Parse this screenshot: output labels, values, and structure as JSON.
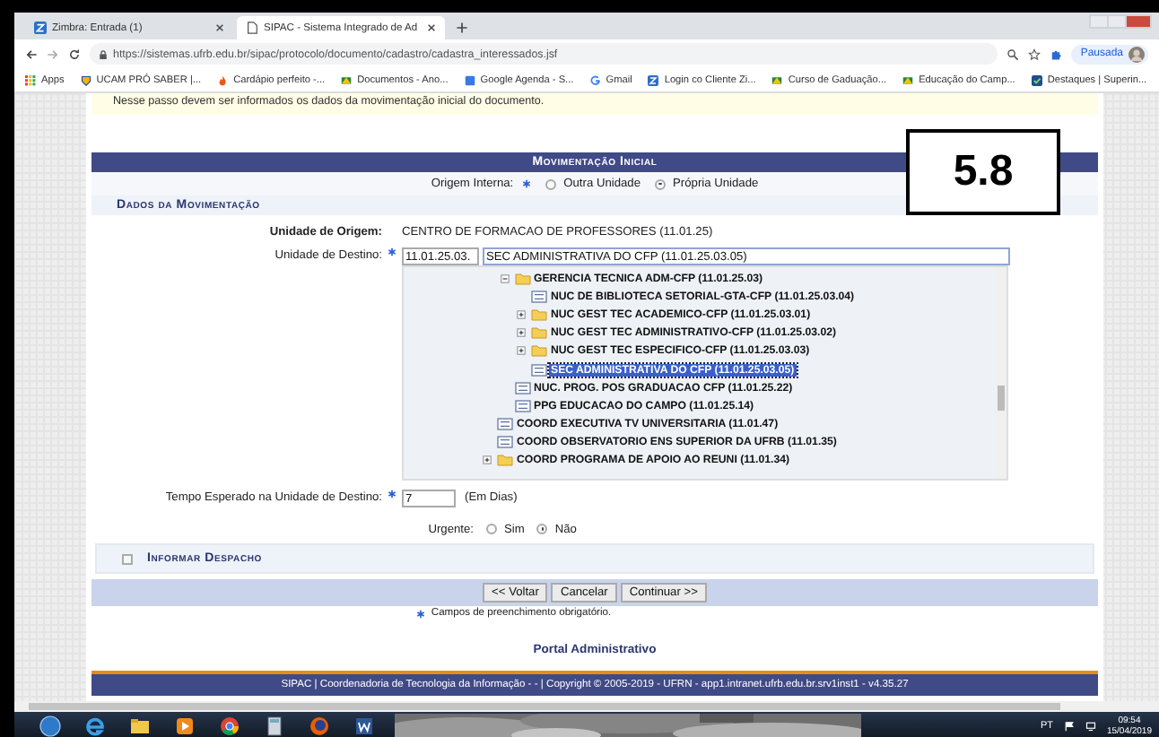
{
  "browser": {
    "tabs": [
      {
        "title": "Zimbra: Entrada (1)",
        "kind": "zimbra",
        "selected": false
      },
      {
        "title": "SIPAC - Sistema Integrado de Ad",
        "kind": "page",
        "selected": true
      }
    ],
    "url": "https://sistemas.ufrb.edu.br/sipac/protocolo/documento/cadastro/cadastra_interessados.jsf",
    "profile": "Pausada",
    "bookmarks": [
      {
        "label": "Apps",
        "kind": "apps"
      },
      {
        "label": "UCAM PRÓ SABER |...",
        "kind": "shield"
      },
      {
        "label": "Cardápio perfeito -...",
        "kind": "flame"
      },
      {
        "label": "Documentos - Ano...",
        "kind": "drive"
      },
      {
        "label": "Google Agenda - S...",
        "kind": "calendar"
      },
      {
        "label": "Gmail",
        "kind": "google"
      },
      {
        "label": "Login co Cliente Zi...",
        "kind": "zimbra"
      },
      {
        "label": "Curso de Gaduação...",
        "kind": "drive"
      },
      {
        "label": "Educação do Camp...",
        "kind": "drive"
      },
      {
        "label": "Destaques | Superin...",
        "kind": "check"
      }
    ]
  },
  "page": {
    "notice": "Nesse passo devem ser informados os dados da movimentação inicial do documento.",
    "title": "Movimentação Inicial",
    "origin": {
      "label": "Origem Interna:",
      "required": true,
      "options": [
        {
          "label": "Outra Unidade",
          "selected": false
        },
        {
          "label": "Própria Unidade",
          "selected": true
        }
      ]
    },
    "section": "Dados da Movimentação",
    "origin_unit": {
      "label": "Unidade de Origem:",
      "value": "CENTRO DE FORMACAO DE PROFESSORES (11.01.25)"
    },
    "destination": {
      "label": "Unidade de Destino:",
      "required": true,
      "code": "11.01.25.03.",
      "name": "SEC ADMINISTRATIVA DO CFP (11.01.25.03.05)"
    },
    "tree": {
      "items": [
        {
          "children": [
            {
              "label": "GERENCIA TECNICA ADM-CFP (11.01.25.03)",
              "kind": "folder",
              "expanded": true,
              "selected": false,
              "children": [
                {
                  "label": "NUC DE BIBLIOTECA SETORIAL-GTA-CFP (11.01.25.03.04)",
                  "kind": "leaf",
                  "selected": false
                },
                {
                  "label": "NUC GEST TEC ACADEMICO-CFP (11.01.25.03.01)",
                  "kind": "folder",
                  "expanded": false,
                  "selected": false
                },
                {
                  "label": "NUC GEST TEC ADMINISTRATIVO-CFP (11.01.25.03.02)",
                  "kind": "folder",
                  "expanded": false,
                  "selected": false
                },
                {
                  "label": "NUC GEST TEC ESPECIFICO-CFP (11.01.25.03.03)",
                  "kind": "folder",
                  "expanded": false,
                  "selected": false
                },
                {
                  "label": "SEC ADMINISTRATIVA DO CFP (11.01.25.03.05)",
                  "kind": "leaf",
                  "selected": true
                }
              ]
            },
            {
              "label": "NUC. PROG. POS GRADUACAO CFP (11.01.25.22)",
              "kind": "leaf",
              "selected": false
            },
            {
              "label": "PPG EDUCACAO DO CAMPO (11.01.25.14)",
              "kind": "leaf",
              "selected": false
            }
          ]
        },
        {
          "label": "COORD EXECUTIVA TV UNIVERSITARIA (11.01.47)",
          "kind": "leaf",
          "selected": false
        },
        {
          "label": "COORD OBSERVATORIO ENS SUPERIOR DA UFRB (11.01.35)",
          "kind": "leaf",
          "selected": false
        },
        {
          "label": "COORD PROGRAMA DE APOIO AO REUNI (11.01.34)",
          "kind": "folder",
          "expanded": false,
          "selected": false
        }
      ]
    },
    "expected_time": {
      "label": "Tempo Esperado na Unidade de Destino:",
      "required": true,
      "value": "7",
      "unit": "(Em Dias)"
    },
    "urgent": {
      "label": "Urgente:",
      "options": [
        {
          "label": "Sim",
          "selected": false
        },
        {
          "label": "Não",
          "selected": true
        }
      ]
    },
    "dispatch": {
      "label": "Informar Despacho",
      "checked": false
    },
    "buttons": [
      "<< Voltar",
      "Cancelar",
      "Continuar >>"
    ],
    "required_note": "Campos de preenchimento obrigatório.",
    "portal_link": "Portal Administrativo",
    "footer": "SIPAC | Coordenadoria de Tecnologia da Informação - - | Copyright © 2005-2019 - UFRN - app1.intranet.ufrb.edu.br.srv1inst1 - v4.35.27"
  },
  "badge": "5.8",
  "taskbar": {
    "language": "PT",
    "time": "09:54",
    "date": "15/04/2019"
  }
}
